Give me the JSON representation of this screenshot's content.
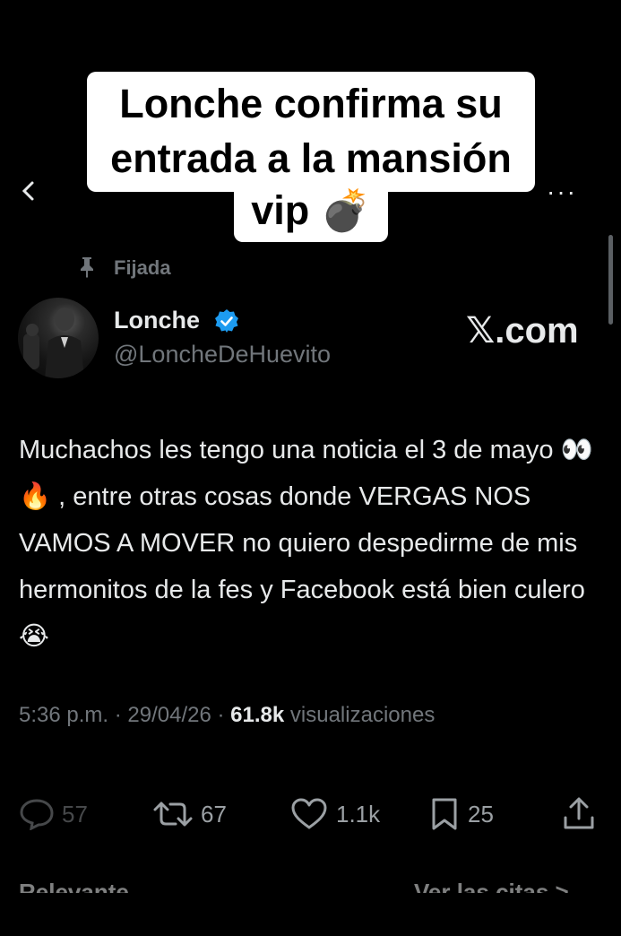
{
  "caption": {
    "line1": "Lonche confirma su",
    "line2": "entrada a la mansión",
    "line3": "vip 💣"
  },
  "top_bar": {
    "more_label": "···"
  },
  "pinned": {
    "label": "Fijada"
  },
  "author": {
    "name": "Lonche",
    "handle": "@LoncheDeHuevito",
    "verified_color": "#1d9bf0"
  },
  "source": {
    "label": "𝕏.com"
  },
  "tweet": {
    "text": "Muchachos les tengo una noticia el 3 de mayo 👀 🔥 , entre otras cosas donde VERGAS NOS VAMOS A MOVER no quiero despedirme de mis hermonitos de la fes y Facebook está bien culero 😭"
  },
  "meta": {
    "time": "5:36 p.m.",
    "sep": "·",
    "date": "29/04/26",
    "views_count": "61.8k",
    "views_label": "visualizaciones"
  },
  "actions": {
    "replies": "57",
    "reposts": "67",
    "likes": "1.1k",
    "bookmarks": "25"
  },
  "footer": {
    "relevant_label": "Relevante ⌄",
    "quotes_label": "Ver las citas >"
  },
  "colors": {
    "background": "#000000",
    "text": "#e7e9ea",
    "muted": "#71767b",
    "accent": "#1d9bf0"
  }
}
